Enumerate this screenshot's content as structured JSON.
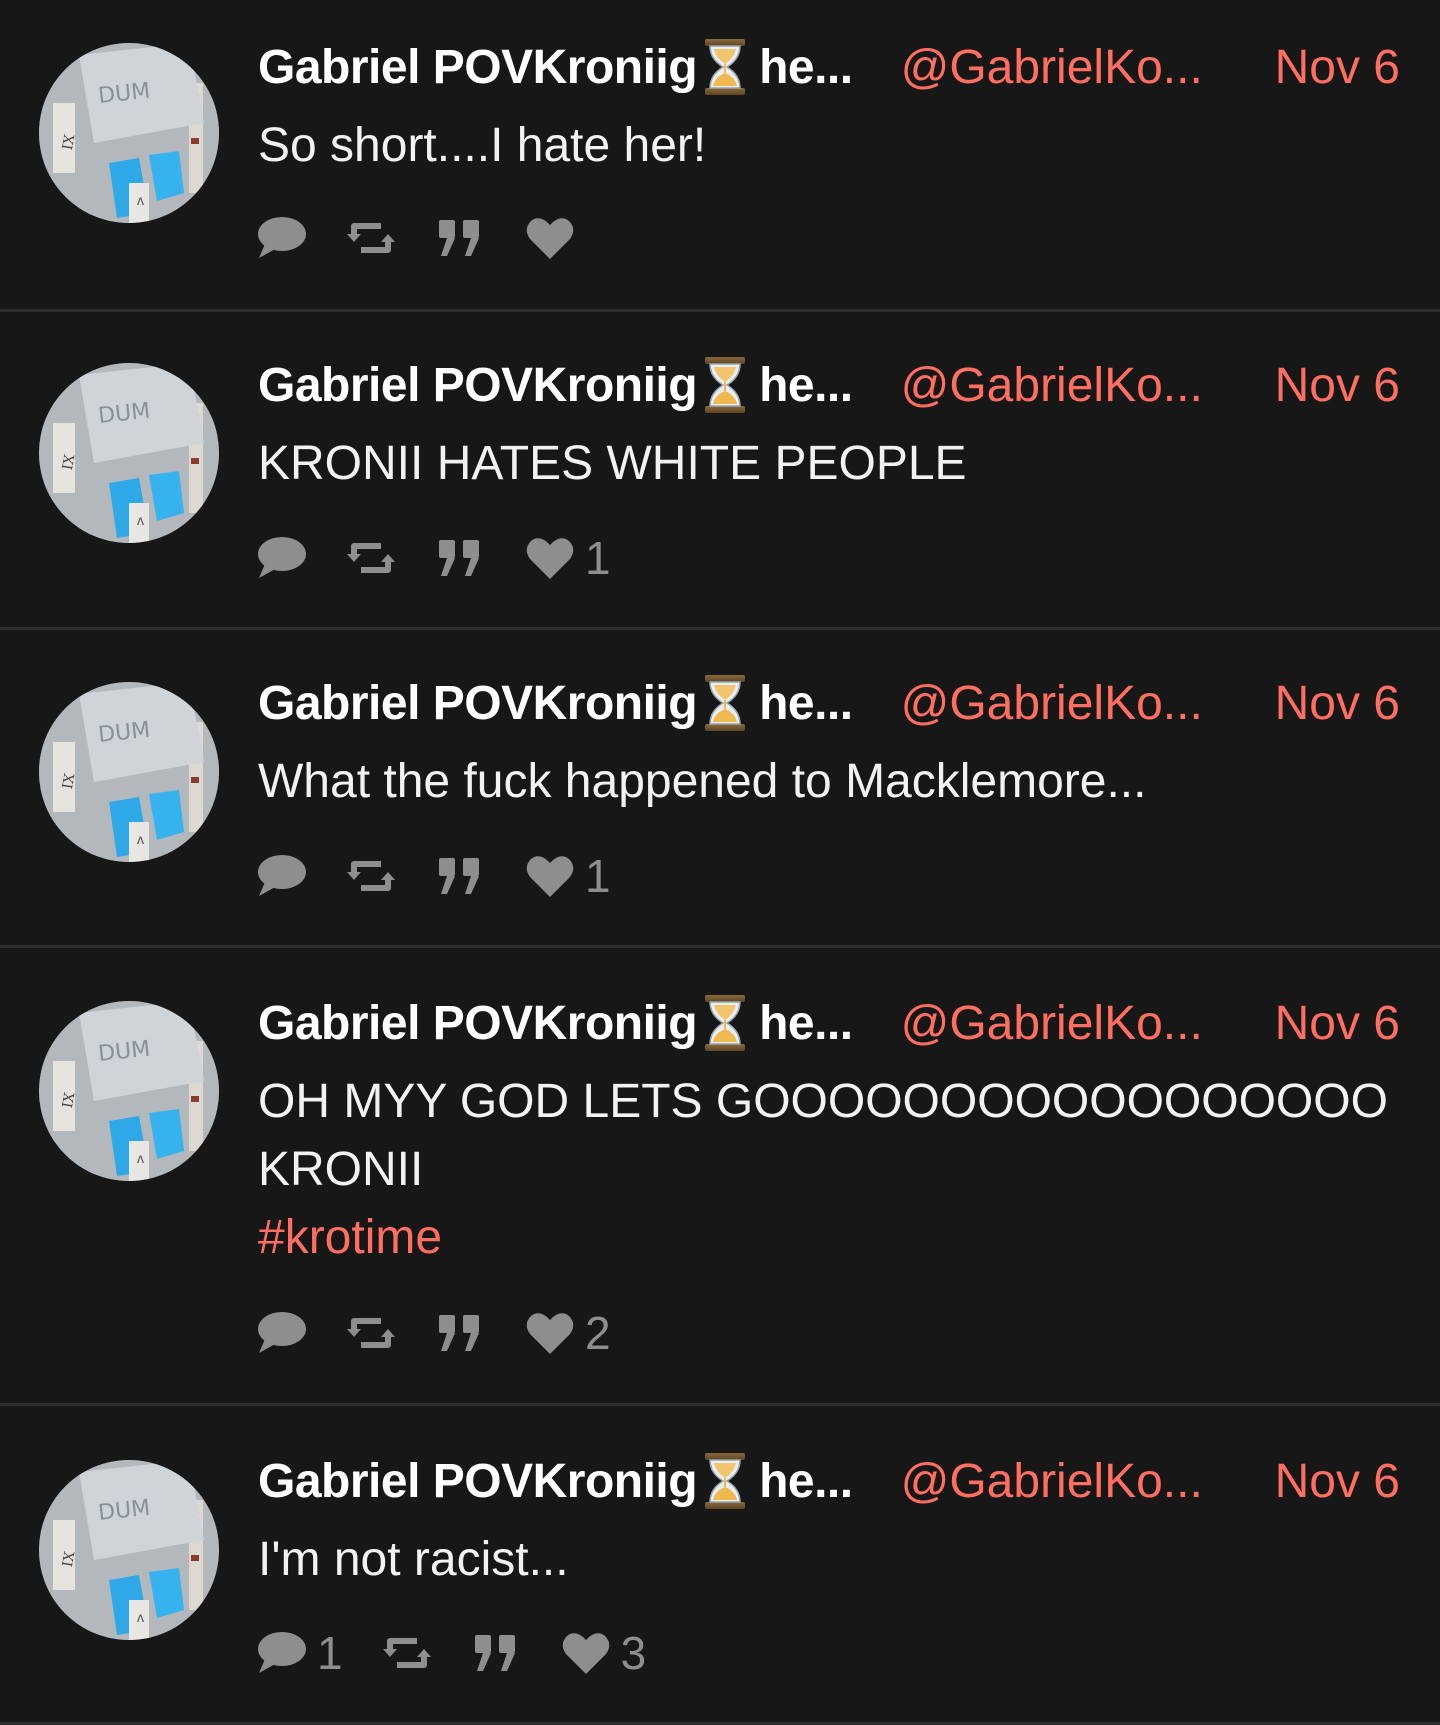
{
  "author": {
    "name": "Gabriel POVKroniig",
    "name_suffix": "he...",
    "handle": "@GabrielKo...",
    "avatar_text": "DUM",
    "badge_icon": "hourglass-icon"
  },
  "colors": {
    "background": "#171717",
    "accent": "#ff6f61",
    "text": "#f2f2f2",
    "muted": "#8e8e8e",
    "divider": "#2e2e2e"
  },
  "posts": [
    {
      "date": "Nov 6",
      "lines": [
        "So short....I hate her!"
      ],
      "hashtag": "",
      "reply_count": "",
      "like_count": ""
    },
    {
      "date": "Nov 6",
      "lines": [
        "KRONII HATES WHITE PEOPLE"
      ],
      "hashtag": "",
      "reply_count": "",
      "like_count": "1"
    },
    {
      "date": "Nov 6",
      "lines": [
        "What the fuck happened to Macklemore..."
      ],
      "hashtag": "",
      "reply_count": "",
      "like_count": "1"
    },
    {
      "date": "Nov 6",
      "lines": [
        "OH MYY GOD LETS GOOOOOOOOOOOOOOOOO",
        "KRONII"
      ],
      "hashtag": "#krotime",
      "reply_count": "",
      "like_count": "2"
    },
    {
      "date": "Nov 6",
      "lines": [
        "I'm not racist..."
      ],
      "hashtag": "",
      "reply_count": "1",
      "like_count": "3"
    }
  ],
  "action_icons": [
    "reply-icon",
    "repost-icon",
    "quote-icon",
    "like-icon"
  ]
}
